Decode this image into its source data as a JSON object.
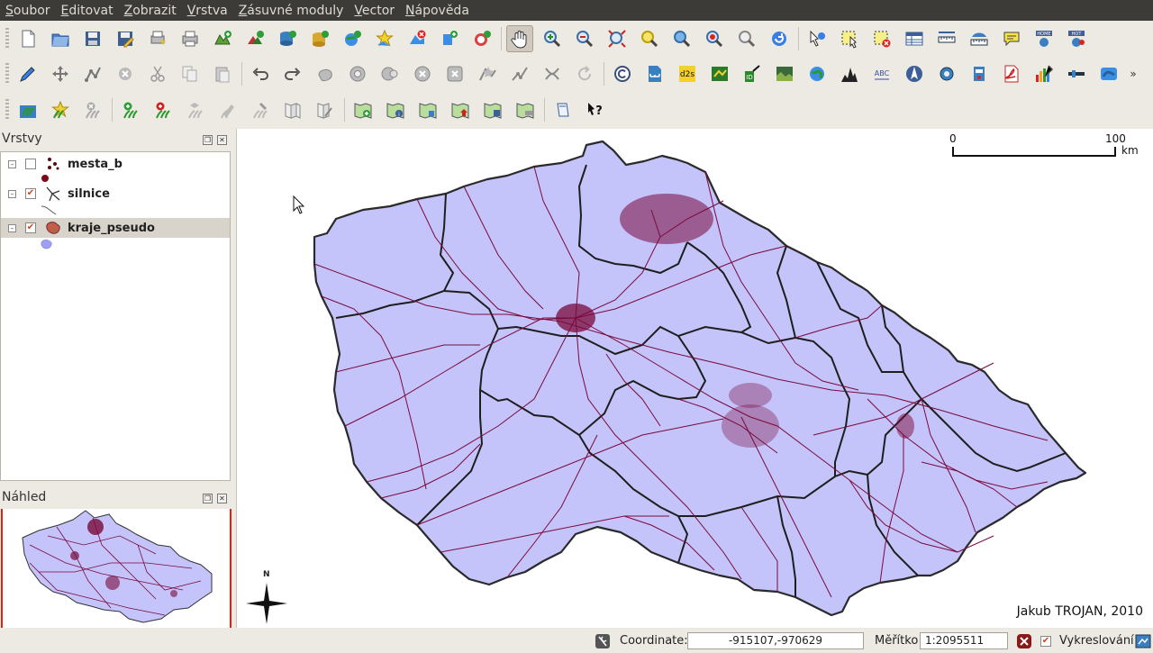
{
  "menu": {
    "items": [
      "Soubor",
      "Editovat",
      "Zobrazit",
      "Vrstva",
      "Zásuvné moduly",
      "Vector",
      "Nápověda"
    ]
  },
  "layers_panel": {
    "title": "Vrstvy",
    "layers": [
      {
        "name": "mesta_b",
        "checked": false,
        "icon": "point-layer-icon"
      },
      {
        "name": "silnice",
        "checked": true,
        "icon": "line-layer-icon"
      },
      {
        "name": "kraje_pseudo",
        "checked": true,
        "icon": "polygon-layer-icon"
      }
    ]
  },
  "overview_panel": {
    "title": "Náhled"
  },
  "map": {
    "scale_start": "0",
    "scale_end": "100",
    "scale_unit": "km",
    "north_label": "N",
    "credit": "Jakub TROJAN, 2010",
    "fill_color": "#c4c4fb",
    "road_color": "#7a0a3a",
    "border_color": "#2a2a2a"
  },
  "statusbar": {
    "coordinate_label": "Coordinate:",
    "coordinate_value": "-915107,-970629",
    "scale_label": "Měřítko",
    "scale_value": "1:2095511",
    "render_label": "Vykreslování",
    "render_checked": true
  }
}
